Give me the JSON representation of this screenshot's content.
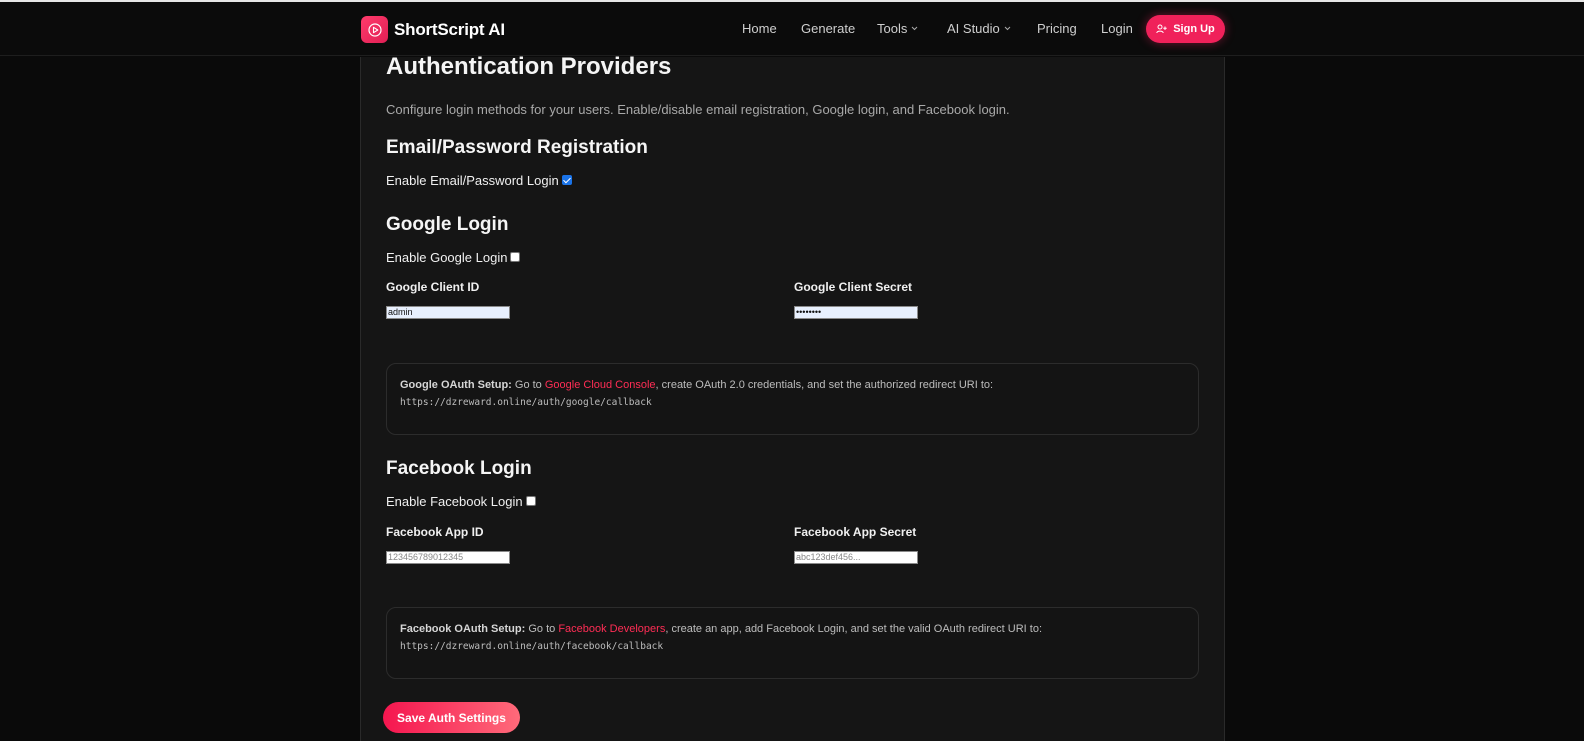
{
  "brand": {
    "name": "ShortScript AI",
    "icon": "play-icon",
    "accent": "#f0215a"
  },
  "nav": {
    "home": "Home",
    "generate": "Generate",
    "tools": "Tools",
    "ai_studio": "AI Studio",
    "pricing": "Pricing",
    "login": "Login",
    "signup": "Sign Up"
  },
  "page": {
    "title": "Authentication Providers",
    "description": "Configure login methods for your users. Enable/disable email registration, Google login, and Facebook login."
  },
  "email": {
    "heading": "Email/Password Registration",
    "enable_label": "Enable Email/Password Login",
    "enabled": true
  },
  "google": {
    "heading": "Google Login",
    "enable_label": "Enable Google Login",
    "enabled": false,
    "client_id_label": "Google Client ID",
    "client_id_value": "admin",
    "client_secret_label": "Google Client Secret",
    "client_secret_value": "••••••••",
    "info_title": "Google OAuth Setup:",
    "info_text_1": " Go to ",
    "info_link": "Google Cloud Console",
    "info_text_2": ", create OAuth 2.0 credentials, and set the authorized redirect URI to:",
    "redirect_uri": "https://dzreward.online/auth/google/callback"
  },
  "facebook": {
    "heading": "Facebook Login",
    "enable_label": "Enable Facebook Login",
    "enabled": false,
    "app_id_label": "Facebook App ID",
    "app_id_placeholder": "123456789012345",
    "app_secret_label": "Facebook App Secret",
    "app_secret_placeholder": "abc123def456...",
    "info_title": "Facebook OAuth Setup:",
    "info_text_1": " Go to ",
    "info_link": "Facebook Developers",
    "info_text_2": ", create an app, add Facebook Login, and set the valid OAuth redirect URI to:",
    "redirect_uri": "https://dzreward.online/auth/facebook/callback"
  },
  "actions": {
    "save_label": "Save Auth Settings"
  }
}
